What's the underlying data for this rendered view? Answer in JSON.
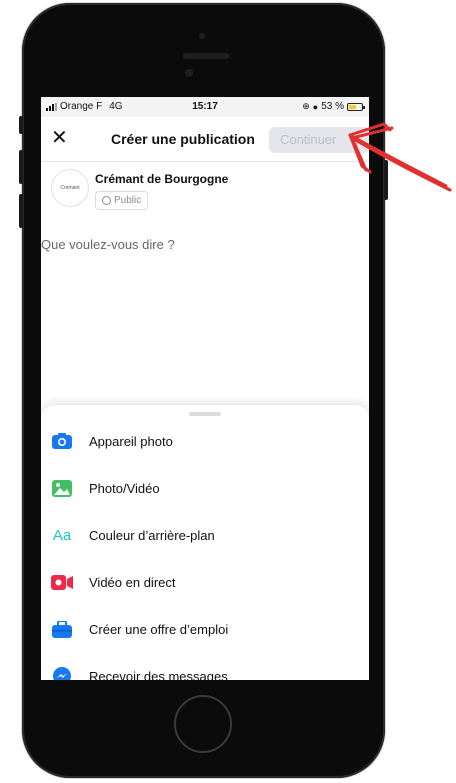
{
  "status_bar": {
    "carrier": "Orange F",
    "network": "4G",
    "time": "15:17",
    "battery_percent": "53 %"
  },
  "header": {
    "title": "Créer une publication",
    "continue_label": "Continuer"
  },
  "author": {
    "name": "Crémant de Bourgogne",
    "avatar_text": "Crémant",
    "audience": "Public"
  },
  "composer": {
    "placeholder": "Que voulez-vous dire ?"
  },
  "options": [
    {
      "label": "Appareil photo",
      "icon": "camera-icon",
      "color": "#1877f2"
    },
    {
      "label": "Photo/Vidéo",
      "icon": "photo-icon",
      "color": "#45bd62"
    },
    {
      "label": "Couleur d’arrière-plan",
      "icon": "text-color-icon",
      "color": "#1cc8b6"
    },
    {
      "label": "Vidéo en direct",
      "icon": "live-video-icon",
      "color": "#f02849"
    },
    {
      "label": "Créer une offre d’emploi",
      "icon": "briefcase-icon",
      "color": "#1877f2"
    },
    {
      "label": "Recevoir des messages",
      "icon": "messenger-icon",
      "color": "#1877f2"
    }
  ],
  "colors": {
    "accent_red": "#e03131",
    "battery_yellow": "#f5d01d",
    "fb_blue": "#1877f2"
  }
}
